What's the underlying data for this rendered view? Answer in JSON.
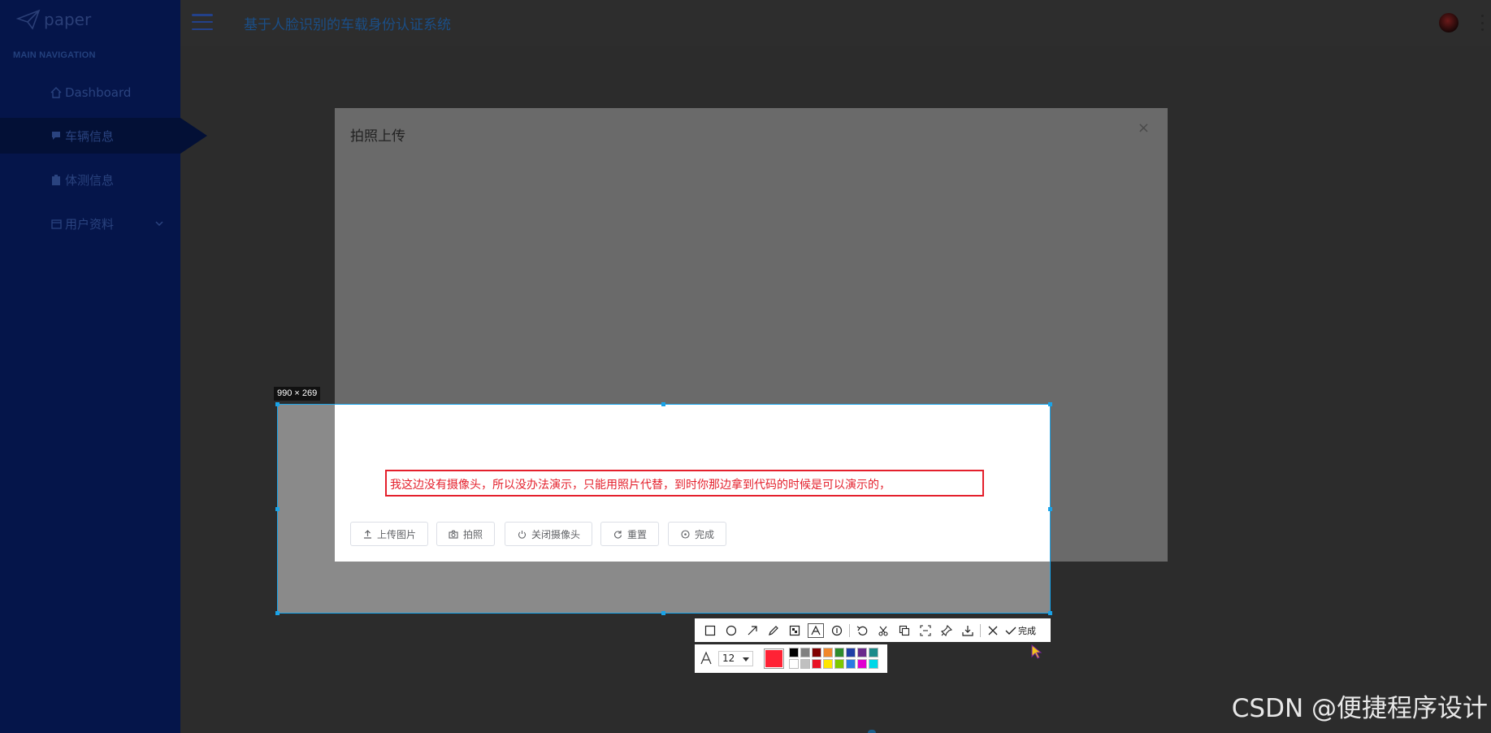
{
  "app": {
    "logo_text": "paper",
    "title": "基于人脸识别的车载身份认证系统"
  },
  "sidebar": {
    "header": "MAIN NAVIGATION",
    "items": [
      {
        "label": "Dashboard",
        "icon": "home-icon"
      },
      {
        "label": "车辆信息",
        "icon": "chat-icon",
        "active": true
      },
      {
        "label": "体测信息",
        "icon": "clipboard-icon"
      },
      {
        "label": "用户资料",
        "icon": "calendar-icon",
        "has_submenu": true
      }
    ]
  },
  "dialog": {
    "title": "拍照上传",
    "close": "×",
    "buttons": [
      {
        "label": "上传图片",
        "icon": "upload-icon"
      },
      {
        "label": "拍照",
        "icon": "camera-icon"
      },
      {
        "label": "关闭摄像头",
        "icon": "power-icon"
      },
      {
        "label": "重置",
        "icon": "refresh-icon"
      },
      {
        "label": "完成",
        "icon": "circle-check-icon"
      }
    ]
  },
  "capture": {
    "size_label": "990 × 269",
    "annotation_text": "我这边没有摄像头，所以没办法演示，只能用照片代替，到时你那边拿到代码的时候是可以演示的，",
    "annotation_color": "#e4202c",
    "selection_color": "#1aa3e8"
  },
  "toolbar": {
    "tools": [
      "rectangle-icon",
      "ellipse-icon",
      "arrow-icon",
      "pen-icon",
      "mosaic-icon",
      "text-icon",
      "number-icon",
      "undo-icon",
      "cut-icon",
      "copy-icon",
      "ocr-icon",
      "pin-icon",
      "save-icon",
      "cancel-icon"
    ],
    "selected_tool": "text-icon",
    "done_label": "完成",
    "font_size": "12",
    "current_color": "#ff2235",
    "palette": [
      "#000000",
      "#808080",
      "#800000",
      "#f0882c",
      "#2d8c2d",
      "#1f3fa6",
      "#6a2a8c",
      "#1b8a8a",
      "#ffffff",
      "#c0c0c0",
      "#e81123",
      "#ffe600",
      "#7ec800",
      "#2a7ae2",
      "#e000d0",
      "#00d8e8"
    ]
  },
  "watermark": "CSDN @便捷程序设计"
}
